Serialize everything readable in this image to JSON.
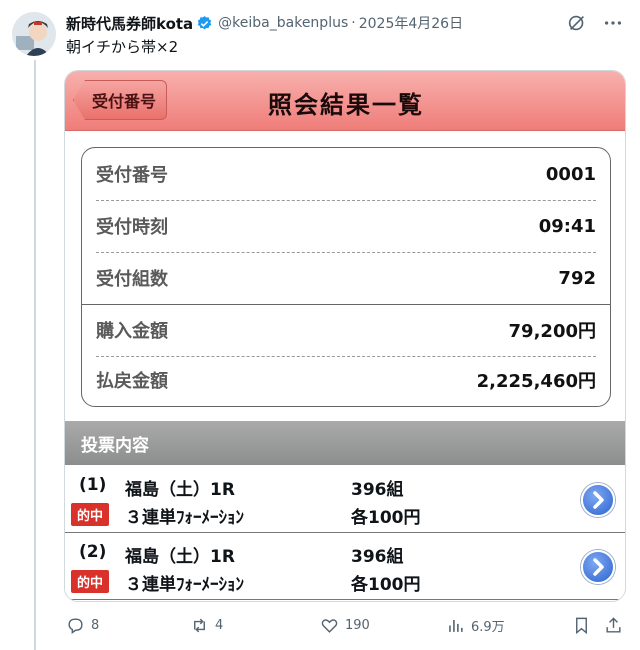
{
  "post": {
    "display_name": "新時代馬券師kota",
    "handle": "@keiba_bakenplus",
    "separator": "·",
    "date": "2025年4月26日",
    "text": "朝イチから帯×2"
  },
  "screen": {
    "back_label": "受付番号",
    "title": "照会結果一覧",
    "summary": [
      {
        "label": "受付番号",
        "value": "0001"
      },
      {
        "label": "受付時刻",
        "value": "09:41"
      },
      {
        "label": "受付組数",
        "value": "792"
      },
      {
        "label": "購入金額",
        "value": "79,200円"
      },
      {
        "label": "払戻金額",
        "value": "2,225,460円"
      }
    ],
    "section_title": "投票内容",
    "bets": [
      {
        "num": "(1)",
        "race": "福島（土）1R",
        "combos": "396組",
        "badge": "的中",
        "type": "３連単ﾌｫｰﾒｰｼｮﾝ",
        "amount": "各100円"
      },
      {
        "num": "(2)",
        "race": "福島（土）1R",
        "combos": "396組",
        "badge": "的中",
        "type": "３連単ﾌｫｰﾒｰｼｮﾝ",
        "amount": "各100円"
      }
    ]
  },
  "actions": {
    "replies": "8",
    "reposts": "4",
    "likes": "190",
    "views": "6.9万"
  },
  "colors": {
    "header_pink": "#ef7d79",
    "hit_red": "#d8322a",
    "verified_blue": "#1d9bf0",
    "section_gray": "#8c8e8d"
  }
}
